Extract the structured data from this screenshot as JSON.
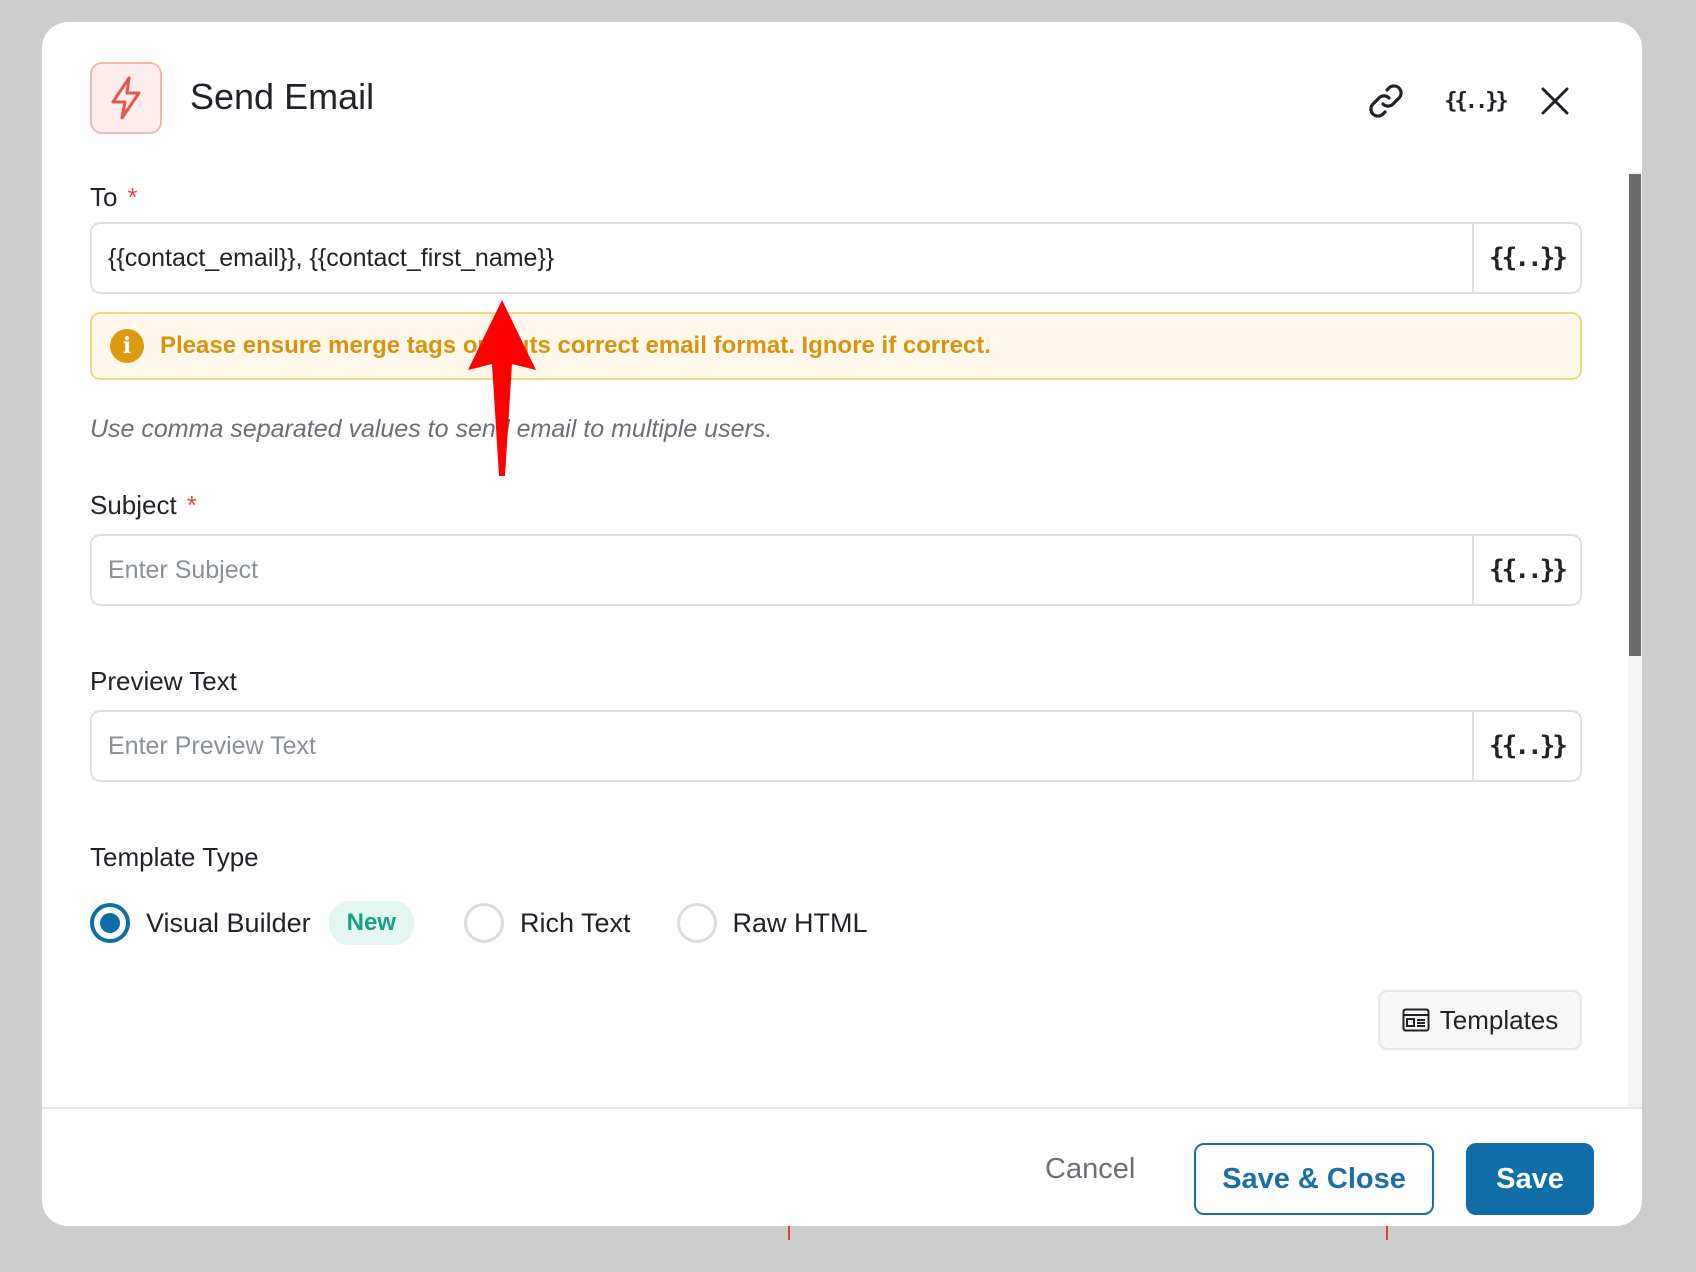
{
  "modal": {
    "title": "Send Email",
    "app_icon": "lightning-bolt-icon",
    "header_actions": {
      "link_icon": "link-icon",
      "merge_tags_label": "{{..}}",
      "close_icon": "close-icon"
    }
  },
  "fields": {
    "to": {
      "label": "To",
      "required_mark": "*",
      "value": "{{contact_email}}, {{contact_first_name}}",
      "merge_tag_label": "{{..}}"
    },
    "warning": {
      "icon": "info-icon",
      "icon_glyph": "i",
      "text": "Please ensure merge tags outputs correct email format. Ignore if correct."
    },
    "help_text": "Use comma separated values to send email to multiple users.",
    "subject": {
      "label": "Subject",
      "required_mark": "*",
      "value": "",
      "placeholder": "Enter Subject",
      "merge_tag_label": "{{..}}"
    },
    "preview_text": {
      "label": "Preview Text",
      "value": "",
      "placeholder": "Enter Preview Text",
      "merge_tag_label": "{{..}}"
    },
    "template_type": {
      "label": "Template Type",
      "options": [
        {
          "label": "Visual Builder",
          "badge": "New",
          "selected": true
        },
        {
          "label": "Rich Text",
          "selected": false
        },
        {
          "label": "Raw HTML",
          "selected": false
        }
      ]
    },
    "templates_button": {
      "label": "Templates",
      "icon": "template-icon"
    }
  },
  "footer": {
    "cancel_label": "Cancel",
    "save_close_label": "Save & Close",
    "save_label": "Save"
  },
  "colors": {
    "primary": "#0f6ea8",
    "warning": "#d69410",
    "required": "#e5484d",
    "badge": "#17a184",
    "annotation_arrow": "#ff0000"
  }
}
